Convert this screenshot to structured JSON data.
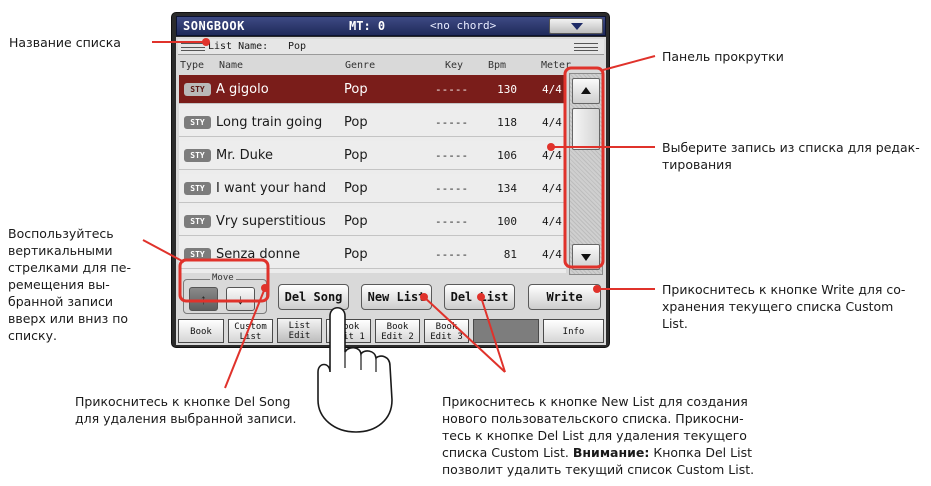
{
  "screen": {
    "app_title": "SONGBOOK",
    "mt_label": "MT: 0",
    "chord_display": "<no chord>",
    "list_name_label": "List Name:",
    "list_name_value": "Pop",
    "columns": [
      "Type",
      "Name",
      "Genre",
      "Key",
      "Bpm",
      "Meter"
    ],
    "rows": [
      {
        "type": "STY",
        "name": "A gigolo",
        "genre": "Pop",
        "key": "-----",
        "bpm": "130",
        "meter": "4/4"
      },
      {
        "type": "STY",
        "name": "Long train going",
        "genre": "Pop",
        "key": "-----",
        "bpm": "118",
        "meter": "4/4"
      },
      {
        "type": "STY",
        "name": "Mr. Duke",
        "genre": "Pop",
        "key": "-----",
        "bpm": "106",
        "meter": "4/4"
      },
      {
        "type": "STY",
        "name": "I want your hand",
        "genre": "Pop",
        "key": "-----",
        "bpm": "134",
        "meter": "4/4"
      },
      {
        "type": "STY",
        "name": "Vry superstitious",
        "genre": "Pop",
        "key": "-----",
        "bpm": "100",
        "meter": "4/4"
      },
      {
        "type": "STY",
        "name": "Senza donne",
        "genre": "Pop",
        "key": "-----",
        "bpm": "81",
        "meter": "4/4"
      }
    ],
    "selected_row": 0,
    "move_label": "Move",
    "move_up_icon": "arrow-up-icon",
    "move_down_icon": "arrow-down-icon",
    "buttons": {
      "del_song": "Del Song",
      "new_list": "New List",
      "del_list": "Del List",
      "write": "Write"
    },
    "tabs": [
      {
        "line1": "Book",
        "line2": ""
      },
      {
        "line1": "Custom",
        "line2": "List"
      },
      {
        "line1": "List",
        "line2": "Edit"
      },
      {
        "line1": "Book",
        "line2": "Edit 1"
      },
      {
        "line1": "Book",
        "line2": "Edit 2"
      },
      {
        "line1": "Book",
        "line2": "Edit 3"
      },
      {
        "line1": "Info",
        "line2": ""
      }
    ],
    "active_tab": 2,
    "colors": {
      "selected_row": "#7a1d1a",
      "callout": "#e0322b",
      "title_bar": "#2a3570"
    }
  },
  "annotations": {
    "list_name": "Название списка",
    "scrollbar": "Панель прокрутки",
    "select_entry": [
      "Выберите запись из списка для редак-",
      "тирования"
    ],
    "move_arrows": [
      "Воспользуйтесь",
      "вертикальными",
      "стрелками для пе-",
      "ремещения вы-",
      "бранной записи",
      "вверх или вниз по",
      "списку."
    ],
    "write": [
      "Прикоснитесь к кнопке Write для со-",
      "хранения текущего списка Custom",
      "List."
    ],
    "del_song": [
      "Прикоснитесь к кнопке Del Song",
      "для удаления выбранной записи."
    ],
    "new_list": {
      "line1": "Прикоснитесь к кнопке New List для создания",
      "line2": "нового пользовательского списка. Прикосни-",
      "line3": "тесь к кнопке Del List для удаления текущего",
      "line4_pre": "списка Custom List. ",
      "line4_bold": "Внимание:",
      "line4_post": " Кнопка Del List",
      "line5": "позволит удалить текущий список Custom List."
    }
  }
}
